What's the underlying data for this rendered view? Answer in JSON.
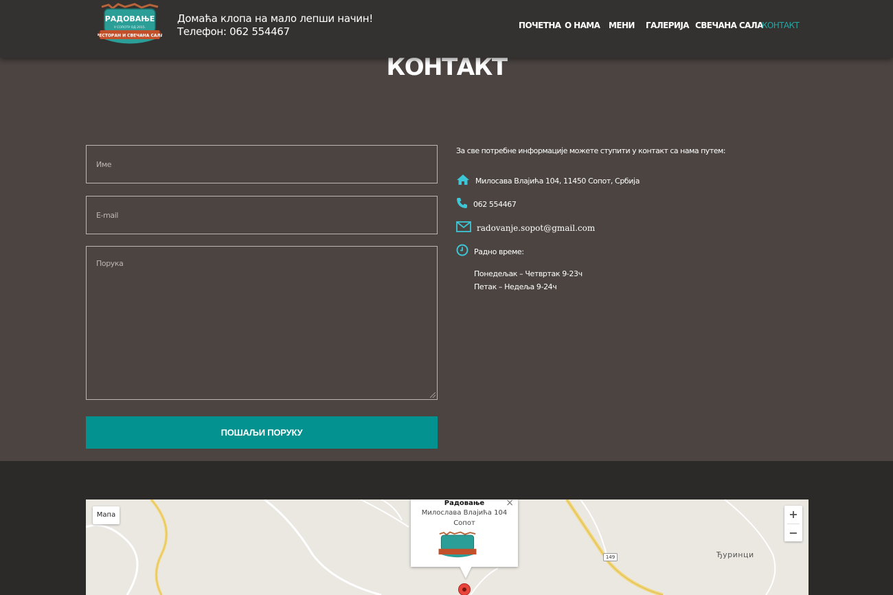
{
  "header": {
    "logo": {
      "text_top": "РАДОВАЊЕ",
      "text_mid": "У СОПОТУ ОД 2015.",
      "text_ribbon": "РЕСТОРАН И СВЕЧАНА САЛА"
    },
    "tagline_line1": "Домаћа клопа на мало лепши начин!",
    "tagline_line2": "Телефон: 062 554467",
    "nav": [
      {
        "label": "ПОЧЕТНА",
        "active": false
      },
      {
        "label": "О НАМА",
        "active": false
      },
      {
        "label": "МЕНИ",
        "active": false
      },
      {
        "label": "ГАЛЕРИЈА",
        "active": false
      },
      {
        "label": "СВЕЧАНА САЛА",
        "active": false
      },
      {
        "label": "КОНТАКТ",
        "active": true
      }
    ]
  },
  "contact": {
    "title": "КОНТАКТ",
    "form": {
      "name_placeholder": "Име",
      "email_placeholder": "E-mail",
      "message_placeholder": "Порука",
      "submit_label": "ПОШАЉИ ПОРУКУ"
    },
    "info": {
      "intro": "За све потребне информације можете ступити у контакт са нама путем:",
      "address": "Милосава Влајића 104, 11450 Сопот, Србија",
      "phone": "062 554467",
      "email": "radovanje.sopot@gmail.com",
      "hours_label": "Радно време:",
      "hours_line1": "Понедељак – Четвртак 9-23ч",
      "hours_line2": "Петак – Недеља 9-24ч"
    }
  },
  "map": {
    "type_button": "Мапа",
    "zoom_in": "+",
    "zoom_out": "−",
    "town_label": "Ђуринци",
    "road_number": "149",
    "popup": {
      "title": "Радовање",
      "address_line1": "Милослава Влајића 104",
      "address_line2": "Сопот",
      "close": "×"
    }
  },
  "colors": {
    "accent": "#22a8a4",
    "button": "#03928f",
    "section_bg": "#4b4441",
    "header_bg": "#333231",
    "icon": "#3cc6d6"
  },
  "icons": [
    "home-icon",
    "phone-icon",
    "envelope-icon",
    "clock-icon"
  ]
}
